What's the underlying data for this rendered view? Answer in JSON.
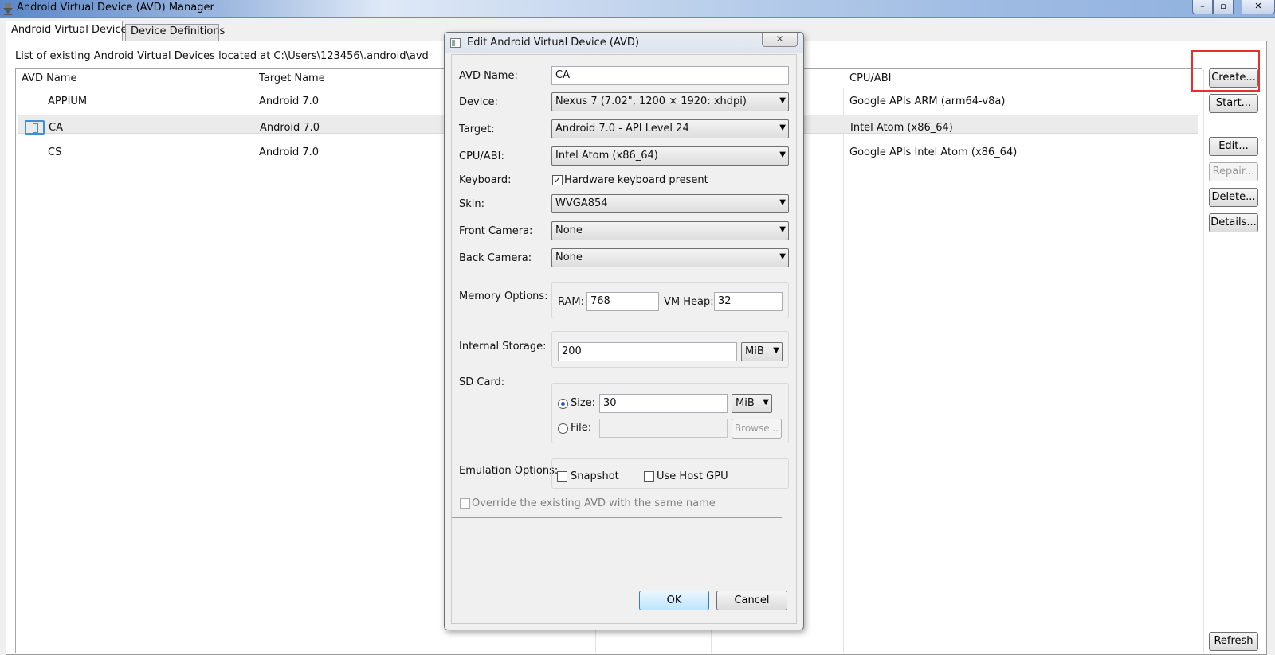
{
  "window": {
    "title": "Android Virtual Device (AVD) Manager",
    "minimize_label": "–",
    "maximize_label": "▫",
    "close_label": "✕"
  },
  "tabs": [
    {
      "label": "Android Virtual Devices",
      "active": true
    },
    {
      "label": "Device Definitions",
      "active": false
    }
  ],
  "main": {
    "caption": "List of existing Android Virtual Devices located at C:\\Users\\123456\\.android\\avd",
    "columns": [
      "AVD Name",
      "Target Name",
      "CPU/ABI"
    ],
    "rows": [
      {
        "name": "APPIUM",
        "target": "Android 7.0",
        "cpu": "Google APIs ARM (arm64-v8a)"
      },
      {
        "name": "CA",
        "target": "Android 7.0",
        "cpu": "Intel Atom (x86_64)",
        "selected": true
      },
      {
        "name": "CS",
        "target": "Android 7.0",
        "cpu": "Google APIs Intel Atom (x86_64)"
      }
    ]
  },
  "side_buttons": {
    "create": "Create...",
    "start": "Start...",
    "edit": "Edit...",
    "repair": "Repair...",
    "delete": "Delete...",
    "details": "Details...",
    "refresh": "Refresh"
  },
  "dialog": {
    "title": "Edit Android Virtual Device (AVD)",
    "close_label": "✕",
    "labels": {
      "avd_name": "AVD Name:",
      "device": "Device:",
      "target": "Target:",
      "cpu_abi": "CPU/ABI:",
      "keyboard": "Keyboard:",
      "skin": "Skin:",
      "front_camera": "Front Camera:",
      "back_camera": "Back Camera:",
      "memory_options": "Memory Options:",
      "ram": "RAM:",
      "vm_heap": "VM Heap:",
      "internal_storage": "Internal Storage:",
      "sd_card": "SD Card:",
      "size": "Size:",
      "file": "File:",
      "emulation_options": "Emulation Options:"
    },
    "values": {
      "avd_name": "CA",
      "device": "Nexus 7 (7.02\", 1200 × 1920: xhdpi)",
      "target": "Android 7.0 - API Level 24",
      "cpu_abi": "Intel Atom (x86_64)",
      "keyboard_checkbox": "Hardware keyboard present",
      "skin": "WVGA854",
      "front_camera": "None",
      "back_camera": "None",
      "ram": "768",
      "vm_heap": "32",
      "internal_storage": "200",
      "internal_storage_unit": "MiB",
      "sd_size": "30",
      "sd_unit": "MiB",
      "sd_file": "",
      "browse": "Browse...",
      "snapshot": "Snapshot",
      "use_host_gpu": "Use Host GPU",
      "override": "Override the existing AVD with the same name",
      "ok": "OK",
      "cancel": "Cancel"
    },
    "check_mark": "✓",
    "dropdown_arrow": "▼"
  },
  "icons": {
    "app": "android-sdk-icon",
    "device": "device-icon"
  },
  "colors": {
    "highlight": "#e53030",
    "selection_row": "#ebebeb",
    "device_icon": "#3f8fd5"
  }
}
